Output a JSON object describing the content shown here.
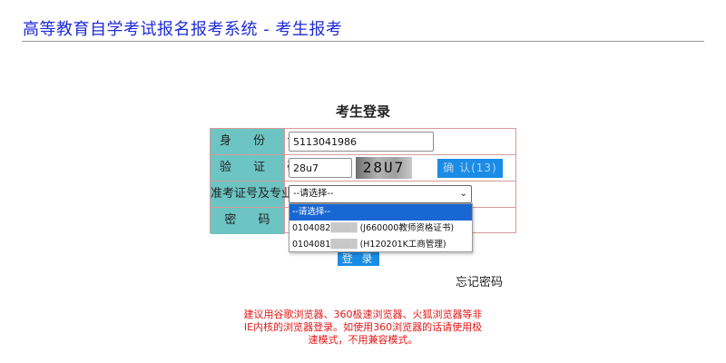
{
  "header": {
    "title": "高等教育自学考试报名报考系统 - 考生报考"
  },
  "login": {
    "title": "考生登录",
    "id_label": "身 份 证",
    "id_value": "5113041986",
    "code_label": "验 证 码",
    "code_value": "28u7",
    "captcha_text": "28U7",
    "confirm_label": "确 认(13)",
    "cert_label": "准考证号及专业",
    "cert_selected": "--请选择--",
    "password_label": "密 码",
    "submit_label": "登 录",
    "forgot_label": "忘记密码"
  },
  "dropdown": {
    "options": [
      {
        "prefix": "--请选择--",
        "suffix": ""
      },
      {
        "prefix": "0104082",
        "suffix": "(J660000教师资格证书)"
      },
      {
        "prefix": "0104081",
        "suffix": "(H120201K工商管理)"
      }
    ]
  },
  "notice": {
    "text": "建议用谷歌浏览器、360极速浏览器、火狐浏览器等非IE内核的浏览器登录。如使用360浏览器的话请使用极速模式，不用兼容模式。"
  }
}
